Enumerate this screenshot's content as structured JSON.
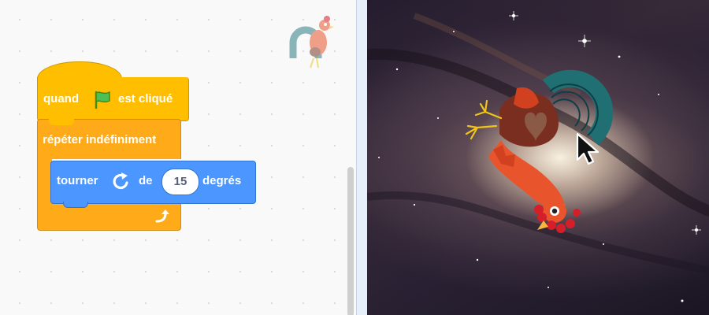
{
  "code_area": {
    "hat_block": {
      "label_before": "quand",
      "flag_icon": "green-flag-icon",
      "label_after": "est cliqué"
    },
    "repeat_block": {
      "label": "répéter indéfiniment",
      "loop_icon": "loop-arrow-icon"
    },
    "motion_block": {
      "label_turn": "tourner",
      "rotate_icon": "rotate-clockwise-icon",
      "label_de": "de",
      "degrees_value": "15",
      "label_degrees": "degrés"
    },
    "sprite_thumbnail": "rooster-sprite-icon"
  },
  "stage": {
    "backdrop": "galaxy",
    "sprite": "rooster-sprite",
    "cursor": "mouse-pointer-icon"
  },
  "colors": {
    "events": "#ffbf00",
    "control": "#ffab19",
    "motion": "#4c97ff"
  }
}
